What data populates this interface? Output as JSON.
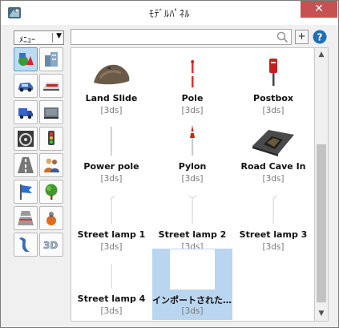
{
  "window": {
    "title": "ﾓﾃﾞﾙﾊﾟﾈﾙ",
    "close_glyph": "✕"
  },
  "toolbar": {
    "menu_label": "ﾒﾆｭｰ",
    "menu_arrow": "▼"
  },
  "categories": [
    {
      "icon": "shapes-icon",
      "selected": true
    },
    {
      "icon": "buildings-icon",
      "selected": false
    },
    {
      "icon": "car-icon",
      "selected": false
    },
    {
      "icon": "train-icon",
      "selected": false
    },
    {
      "icon": "truck-icon",
      "selected": false
    },
    {
      "icon": "container-icon",
      "selected": false
    },
    {
      "icon": "steering-wheel-icon",
      "selected": false
    },
    {
      "icon": "traffic-light-icon",
      "selected": false
    },
    {
      "icon": "road-icon",
      "selected": false
    },
    {
      "icon": "people-icon",
      "selected": false
    },
    {
      "icon": "flag-icon",
      "selected": false
    },
    {
      "icon": "tree-icon",
      "selected": false
    },
    {
      "icon": "crosswalk-icon",
      "selected": false
    },
    {
      "icon": "fire-hydrant-icon",
      "selected": false
    },
    {
      "icon": "curve-shape-icon",
      "selected": false
    },
    {
      "icon": "3d-text-icon",
      "selected": false,
      "label": "3D"
    }
  ],
  "search": {
    "value": "",
    "placeholder": ""
  },
  "buttons": {
    "add": "+",
    "help": "?"
  },
  "models": [
    {
      "name": "Land Slide",
      "format": "[3ds]",
      "icon": "landslide-icon"
    },
    {
      "name": "Pole",
      "format": "[3ds]",
      "icon": "pole-icon"
    },
    {
      "name": "Postbox",
      "format": "[3ds]",
      "icon": "postbox-icon"
    },
    {
      "name": "Power pole",
      "format": "[3ds]",
      "icon": "power-pole-icon"
    },
    {
      "name": "Pylon",
      "format": "[3ds]",
      "icon": "pylon-icon"
    },
    {
      "name": "Road Cave In",
      "format": "[3ds]",
      "icon": "road-cave-in-icon"
    },
    {
      "name": "Street lamp 1",
      "format": "[3ds]",
      "icon": "street-lamp-icon"
    },
    {
      "name": "Street lamp 2",
      "format": "[3ds]",
      "icon": "street-lamp-icon"
    },
    {
      "name": "Street lamp 3",
      "format": "[3ds]",
      "icon": "street-lamp-icon"
    },
    {
      "name": "Street lamp 4",
      "format": "[3ds]",
      "icon": "street-lamp-icon"
    },
    {
      "name": "インポートされたD...",
      "format": "[3ds]",
      "icon": "blank-thumbnail-icon",
      "selected": true
    }
  ],
  "colors": {
    "selection": "#bad5ef",
    "close": "#c75050",
    "accent": "#1e6fb8"
  }
}
